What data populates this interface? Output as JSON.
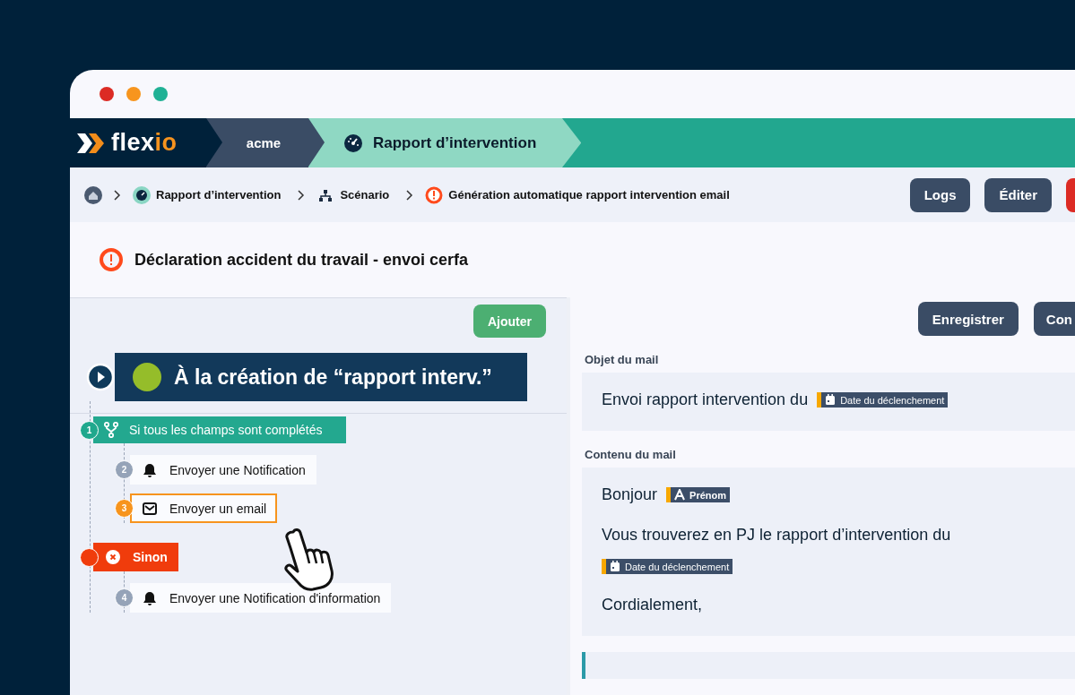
{
  "header": {
    "logo": [
      "flex",
      "io"
    ],
    "segments": [
      {
        "kind": "workspace",
        "label": "acme"
      },
      {
        "kind": "app",
        "label": "Rapport d’intervention"
      }
    ]
  },
  "breadcrumb": {
    "items": [
      {
        "kind": "home"
      },
      {
        "kind": "app",
        "label": "Rapport d’intervention"
      },
      {
        "kind": "scenario",
        "label": "Scénario"
      },
      {
        "kind": "alert",
        "label": "Génération automatique rapport intervention email"
      }
    ],
    "buttons": [
      {
        "kind": "dark",
        "label": "Logs"
      },
      {
        "kind": "dark",
        "label": "Éditer"
      },
      {
        "kind": "danger"
      }
    ]
  },
  "title": "Déclaration accident du travail - envoi cerfa",
  "workflow": {
    "add_button": "Ajouter",
    "trigger": "À la création de “rapport interv.”",
    "steps": [
      {
        "kind": "condition",
        "number": "1",
        "label": "Si tous les champs sont complétés",
        "children": [
          {
            "kind": "notification",
            "number": "2",
            "label": "Envoyer une Notification",
            "selected": false
          },
          {
            "kind": "email",
            "number": "3",
            "label": "Envoyer un email",
            "selected": true
          }
        ]
      },
      {
        "kind": "else",
        "label": "Sinon",
        "children": [
          {
            "kind": "notification",
            "number": "4",
            "label": "Envoyer une Notification d'information",
            "selected": false
          }
        ]
      }
    ]
  },
  "editor": {
    "buttons": [
      "Enregistrer",
      "Con"
    ],
    "fields": [
      {
        "label": "Objet du mail",
        "paragraphs": [
          [
            {
              "kind": "text",
              "text": "Envoi rapport intervention du"
            },
            {
              "kind": "date_token",
              "text": "Date du déclenchement"
            }
          ]
        ]
      },
      {
        "label": "Contenu du mail",
        "paragraphs": [
          [
            {
              "kind": "text",
              "text": "Bonjour"
            },
            {
              "kind": "text_token",
              "text": "Prénom"
            }
          ],
          [
            {
              "kind": "text",
              "text": "Vous trouverez en PJ le rapport d’intervention du"
            },
            {
              "kind": "break"
            },
            {
              "kind": "date_token",
              "text": "Date du déclenchement"
            }
          ],
          [
            {
              "kind": "text",
              "text": "Cordialement,"
            }
          ]
        ]
      }
    ]
  }
}
